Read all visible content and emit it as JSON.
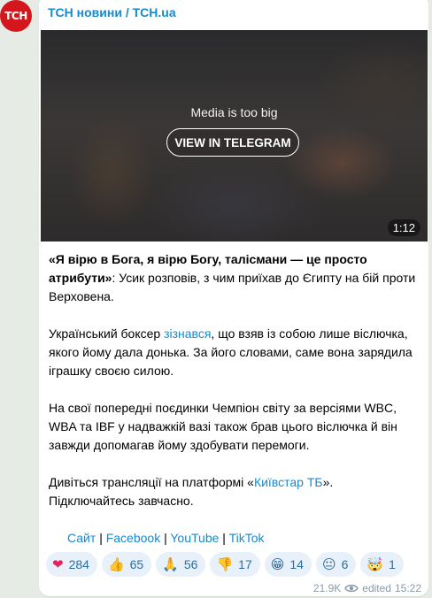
{
  "avatar_text": "ТСН",
  "channel_name": "ТСН новини / TCH.ua",
  "media": {
    "message": "Media is too big",
    "button_label": "VIEW IN TELEGRAM",
    "duration": "1:12"
  },
  "post": {
    "p1_quote": "«Я вірю в Бога, я вірю Богу, талісмани — це просто атрибути»",
    "p1_rest": ": Усик розповів, з чим приїхав до Єгипту на бій проти Верховена.",
    "p2_pre": "Український боксер ",
    "p2_link": "зізнався",
    "p2_post": ", що взяв із собою лише віслючка, якого йому дала донька. За його словами, саме вона зарядила іграшку своєю силою.",
    "p3": "На свої попередні поєдинки Чемпіон світу за версіями WBC, WBA та IBF у надважкій вазі також брав цього віслючка й він завжди допомагав йому здобувати перемоги.",
    "p4_pre": "Дивіться трансляції на платформі «",
    "p4_link": "Київстар ТБ",
    "p4_post": "». Підключайтесь завчасно.",
    "links": {
      "site": "Сайт",
      "facebook": "Facebook",
      "youtube": "YouTube",
      "tiktok": "TikTok",
      "separator": "|"
    }
  },
  "reactions": [
    {
      "emoji": "❤",
      "icon": "red-heart",
      "count": "284"
    },
    {
      "emoji": "👍",
      "icon": "thumbs-up",
      "count": "65"
    },
    {
      "emoji": "🙏",
      "icon": "folded-hands",
      "count": "56"
    },
    {
      "emoji": "👎",
      "icon": "thumbs-down",
      "count": "17"
    },
    {
      "emoji": "😁",
      "icon": "grinning-face",
      "count": "14"
    },
    {
      "emoji": "😐",
      "icon": "neutral-face",
      "count": "6"
    },
    {
      "emoji": "🤯",
      "icon": "exploding-head",
      "count": "1"
    }
  ],
  "meta": {
    "views": "21.9K",
    "edited_label": "edited",
    "time": "15:22"
  },
  "colors": {
    "link": "#168acd",
    "avatar_bg": "#d4161d",
    "reaction_bg": "#e8f1f9"
  }
}
